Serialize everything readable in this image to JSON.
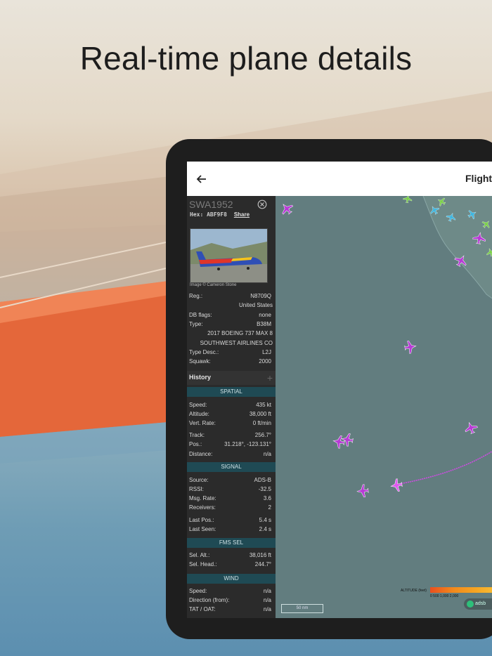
{
  "headline": "Real-time plane details",
  "appbar": {
    "title": "Flight"
  },
  "panel": {
    "callsign": "SWA1952",
    "hex_label": "Hex:",
    "hex_value": "ABF9F8",
    "share": "Share",
    "photo_credit": "Image © Cameron Stone",
    "info": [
      {
        "k": "Reg.:",
        "v": "N8709Q"
      },
      {
        "k": "",
        "v": "United States"
      },
      {
        "k": "DB flags:",
        "v": "none"
      },
      {
        "k": "Type:",
        "v": "B38M"
      },
      {
        "k": "",
        "v": "2017 BOEING 737 MAX 8"
      },
      {
        "k": "",
        "v": "SOUTHWEST AIRLINES CO"
      },
      {
        "k": "Type Desc.:",
        "v": "L2J"
      },
      {
        "k": "Squawk:",
        "v": "2000"
      }
    ],
    "history": "History",
    "history_plus": "+",
    "sections": {
      "spatial": "SPATIAL",
      "signal": "SIGNAL",
      "fms": "FMS SEL",
      "wind": "WIND"
    },
    "spatial": [
      {
        "k": "Speed:",
        "v": "435 kt"
      },
      {
        "k": "Altitude:",
        "v": "38,000 ft"
      },
      {
        "k": "Vert. Rate:",
        "v": "0 ft/min"
      },
      {
        "k": "Track:",
        "v": "256.7°"
      },
      {
        "k": "Pos.:",
        "v": "31.218°, -123.131°"
      },
      {
        "k": "Distance:",
        "v": "n/a"
      }
    ],
    "signal": [
      {
        "k": "Source:",
        "v": "ADS-B"
      },
      {
        "k": "RSSI:",
        "v": "-32.5"
      },
      {
        "k": "Msg. Rate:",
        "v": "3.6"
      },
      {
        "k": "Receivers:",
        "v": "2"
      },
      {
        "k": "Last Pos.:",
        "v": "5.4 s"
      },
      {
        "k": "Last Seen:",
        "v": "2.4 s"
      }
    ],
    "fms": [
      {
        "k": "Sel. Alt.:",
        "v": "38,016 ft"
      },
      {
        "k": "Sel. Head.:",
        "v": "244.7°"
      }
    ],
    "wind": [
      {
        "k": "Speed:",
        "v": "n/a"
      },
      {
        "k": "Direction (from):",
        "v": "n/a"
      },
      {
        "k": "TAT / OAT:",
        "v": "n/a"
      }
    ]
  },
  "map": {
    "scale_label": "50 nm",
    "legend_label": "ALTITUDE (feet)",
    "legend_ticks": "0   500  1,000        2,000",
    "attribution": "adsb"
  },
  "colors": {
    "panel_bg": "#2b2b2b",
    "section_bg": "#1f4a54",
    "map_bg": "#627d7f",
    "plane_purple": "#b83ad6"
  }
}
